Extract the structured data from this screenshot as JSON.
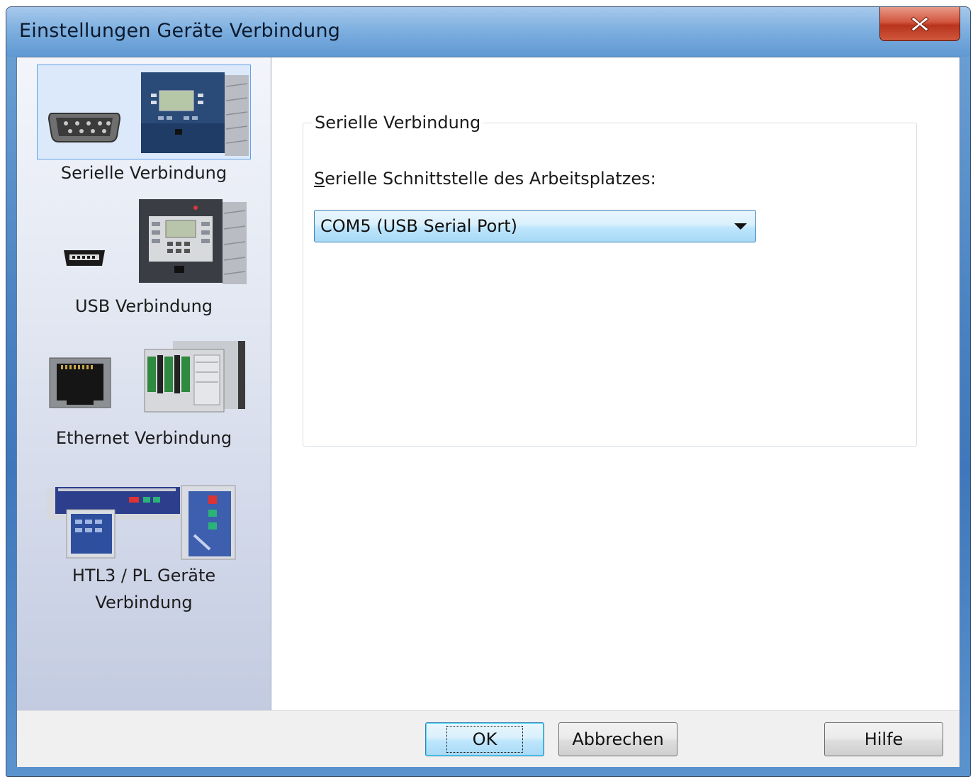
{
  "window": {
    "title": "Einstellungen Geräte Verbindung",
    "close_label": "X"
  },
  "sidebar": {
    "items": [
      {
        "label": "Serielle Verbindung",
        "icon": "serial-port-device-icon",
        "selected": true
      },
      {
        "label": "USB Verbindung",
        "icon": "usb-device-icon",
        "selected": false
      },
      {
        "label": "Ethernet Verbindung",
        "icon": "ethernet-device-icon",
        "selected": false
      },
      {
        "label_line1": "HTL3 / PL Geräte",
        "label_line2": "Verbindung",
        "icon": "htl3-pl-device-icon",
        "selected": false
      }
    ]
  },
  "main": {
    "group_title": "Serielle Verbindung",
    "field_label_first": "S",
    "field_label_rest": "erielle Schnittstelle des Arbeitsplatzes:",
    "port_select_value": "COM5 (USB Serial Port)"
  },
  "footer": {
    "ok_label": "OK",
    "cancel_label": "Abbrechen",
    "help_label": "Hilfe"
  },
  "colors": {
    "selection_bg": "#dbe9fa",
    "selection_border": "#5ea2ea",
    "combo_border": "#3c7fb1"
  }
}
